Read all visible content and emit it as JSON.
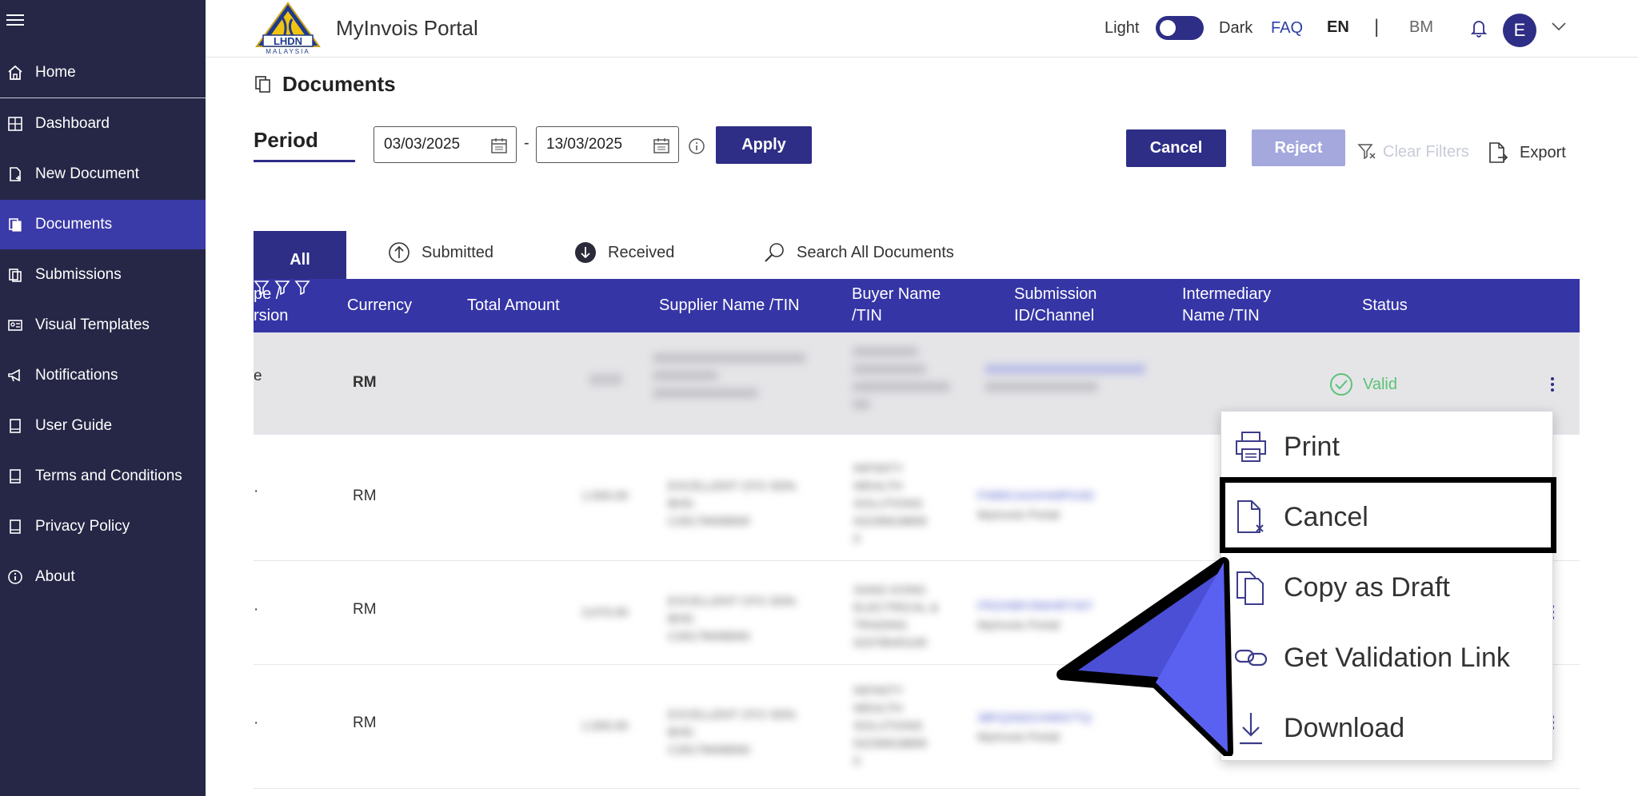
{
  "colors": {
    "sidebar_bg": "#262746",
    "primary": "#2e2e86",
    "table_header": "#3535a6",
    "valid": "#5cc277",
    "reject_disabled": "#a4a8dc",
    "pointer": "#4b4fd6"
  },
  "sidebar": {
    "items": [
      {
        "label": "Home",
        "icon": "home-icon"
      },
      {
        "label": "Dashboard",
        "icon": "dashboard-icon"
      },
      {
        "label": "New Document",
        "icon": "new-document-icon"
      },
      {
        "label": "Documents",
        "icon": "documents-icon",
        "active": true
      },
      {
        "label": "Submissions",
        "icon": "submissions-icon"
      },
      {
        "label": "Visual Templates",
        "icon": "visual-templates-icon"
      },
      {
        "label": "Notifications",
        "icon": "megaphone-icon"
      },
      {
        "label": "User Guide",
        "icon": "book-icon"
      },
      {
        "label": "Terms and Conditions",
        "icon": "book-icon"
      },
      {
        "label": "Privacy Policy",
        "icon": "book-icon"
      },
      {
        "label": "About",
        "icon": "info-icon"
      }
    ]
  },
  "header": {
    "logo_text": "LHDN",
    "logo_sub": "MALAYSIA",
    "app_title": "MyInvois Portal",
    "theme_light": "Light",
    "theme_dark": "Dark",
    "faq": "FAQ",
    "lang_en": "EN",
    "lang_sep": "|",
    "lang_bm": "BM",
    "avatar_initial": "E"
  },
  "page": {
    "title": "Documents"
  },
  "filters": {
    "period_label": "Period",
    "date_from": "03/03/2025",
    "date_sep": "-",
    "date_to": "13/03/2025",
    "apply_label": "Apply",
    "cancel_label": "Cancel",
    "reject_label": "Reject",
    "clear_filters_label": "Clear Filters",
    "export_label": "Export"
  },
  "tabs": {
    "all": "All",
    "submitted": "Submitted",
    "received": "Received",
    "search": "Search All Documents"
  },
  "table": {
    "headers": {
      "type_version": "pe /\nrsion",
      "currency": "Currency",
      "total_amount": "Total Amount",
      "supplier": "Supplier Name /TIN",
      "buyer": "Buyer Name\n/TIN",
      "submission": "Submission\nID/Channel",
      "intermediary": "Intermediary\nName /TIN",
      "status": "Status"
    },
    "rows": [
      {
        "type_fragment": "e",
        "currency": "RM",
        "amount": "",
        "supplier": "",
        "buyer": "",
        "submission": "",
        "channel": "",
        "status": "Valid"
      },
      {
        "type_fragment": "·",
        "currency": "RM",
        "amount": "1,500.00",
        "supplier": "EXCELLENT CFO SDN.\nBHD.\nC26178408000",
        "buyer": "INFINITY\nWEALTH\nSOLUTIONS\n02236618806\n0",
        "submission": "FN89CAAXH40PG3G",
        "channel": "MyInvois Portal",
        "status": ""
      },
      {
        "type_fragment": "·",
        "currency": "RM",
        "amount": "3,670.00",
        "supplier": "EXCELLENT CFO SDN.\nBHD.\nC26178408000",
        "buyer": "SANG KONG\nELECTRICAL &\nTRADING\n02378045100",
        "submission": "FRZH98Y9WHRT457",
        "channel": "MyInvois Portal",
        "status": ""
      },
      {
        "type_fragment": "·",
        "currency": "RM",
        "amount": "1,500.00",
        "supplier": "EXCELLENT CFO SDN.\nBHD.\nC26178408000",
        "buyer": "INFINITY\nWEALTH\nSOLUTIONS\n02236618806\n0",
        "submission": "38FQ3SDCHWN7TQ",
        "channel": "MyInvois Portal",
        "status": ""
      }
    ]
  },
  "context_menu": {
    "items": [
      {
        "label": "Print",
        "icon": "printer-icon"
      },
      {
        "label": "Cancel",
        "icon": "cancel-document-icon"
      },
      {
        "label": "Copy as Draft",
        "icon": "copy-icon"
      },
      {
        "label": "Get Validation Link",
        "icon": "link-icon"
      },
      {
        "label": "Download",
        "icon": "download-icon"
      }
    ]
  }
}
